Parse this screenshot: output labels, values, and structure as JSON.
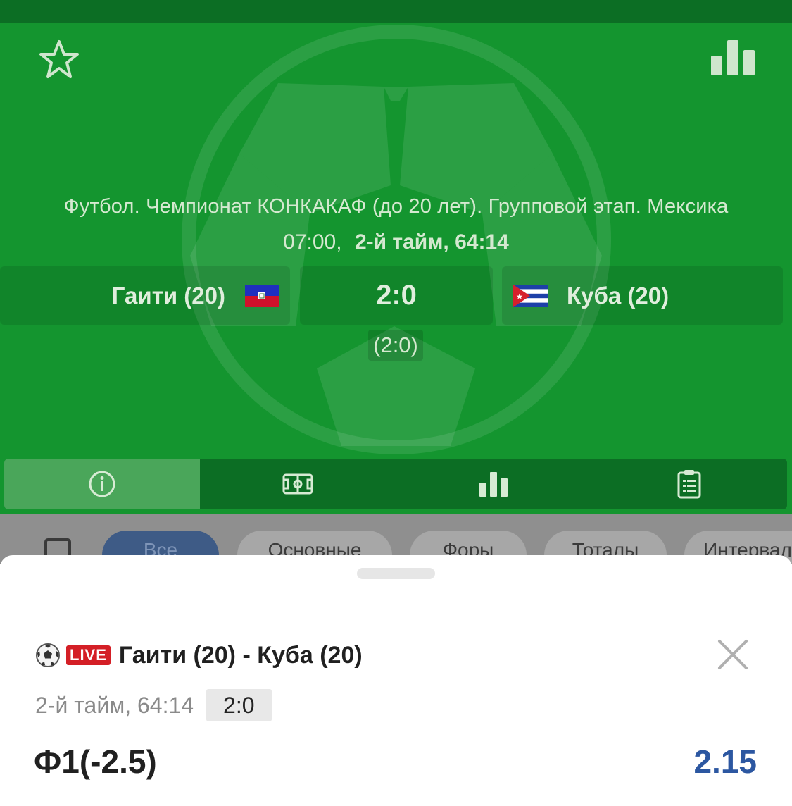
{
  "header": {
    "league": "Футбол. Чемпионат КОНКАКАФ (до 20 лет). Групповой этап. Мексика",
    "start_time": "07:00,",
    "period": "2-й тайм, 64:14",
    "home_team": "Гаити (20)",
    "away_team": "Куба (20)",
    "score": "2:0",
    "half_score": "(2:0)",
    "colors": {
      "header_bg": "#14952f",
      "top_bar": "#0c6e24",
      "odds_blue": "#2c57a1",
      "live_red": "#d41f26"
    }
  },
  "icons": {
    "favorite": "star-outline-icon",
    "statistics": "bar-chart-icon",
    "tabs": [
      "info-icon",
      "field-icon",
      "bar-chart-icon",
      "clipboard-list-icon"
    ]
  },
  "filters": {
    "chips": [
      "Все",
      "Основные",
      "Форы",
      "Тоталы",
      "Интервалы"
    ]
  },
  "bet_slip": {
    "live_label": "LIVE",
    "match": "Гаити (20) - Куба (20)",
    "period": "2-й тайм, 64:14",
    "score": "2:0",
    "bet": "Ф1(-2.5)",
    "odds": "2.15"
  }
}
